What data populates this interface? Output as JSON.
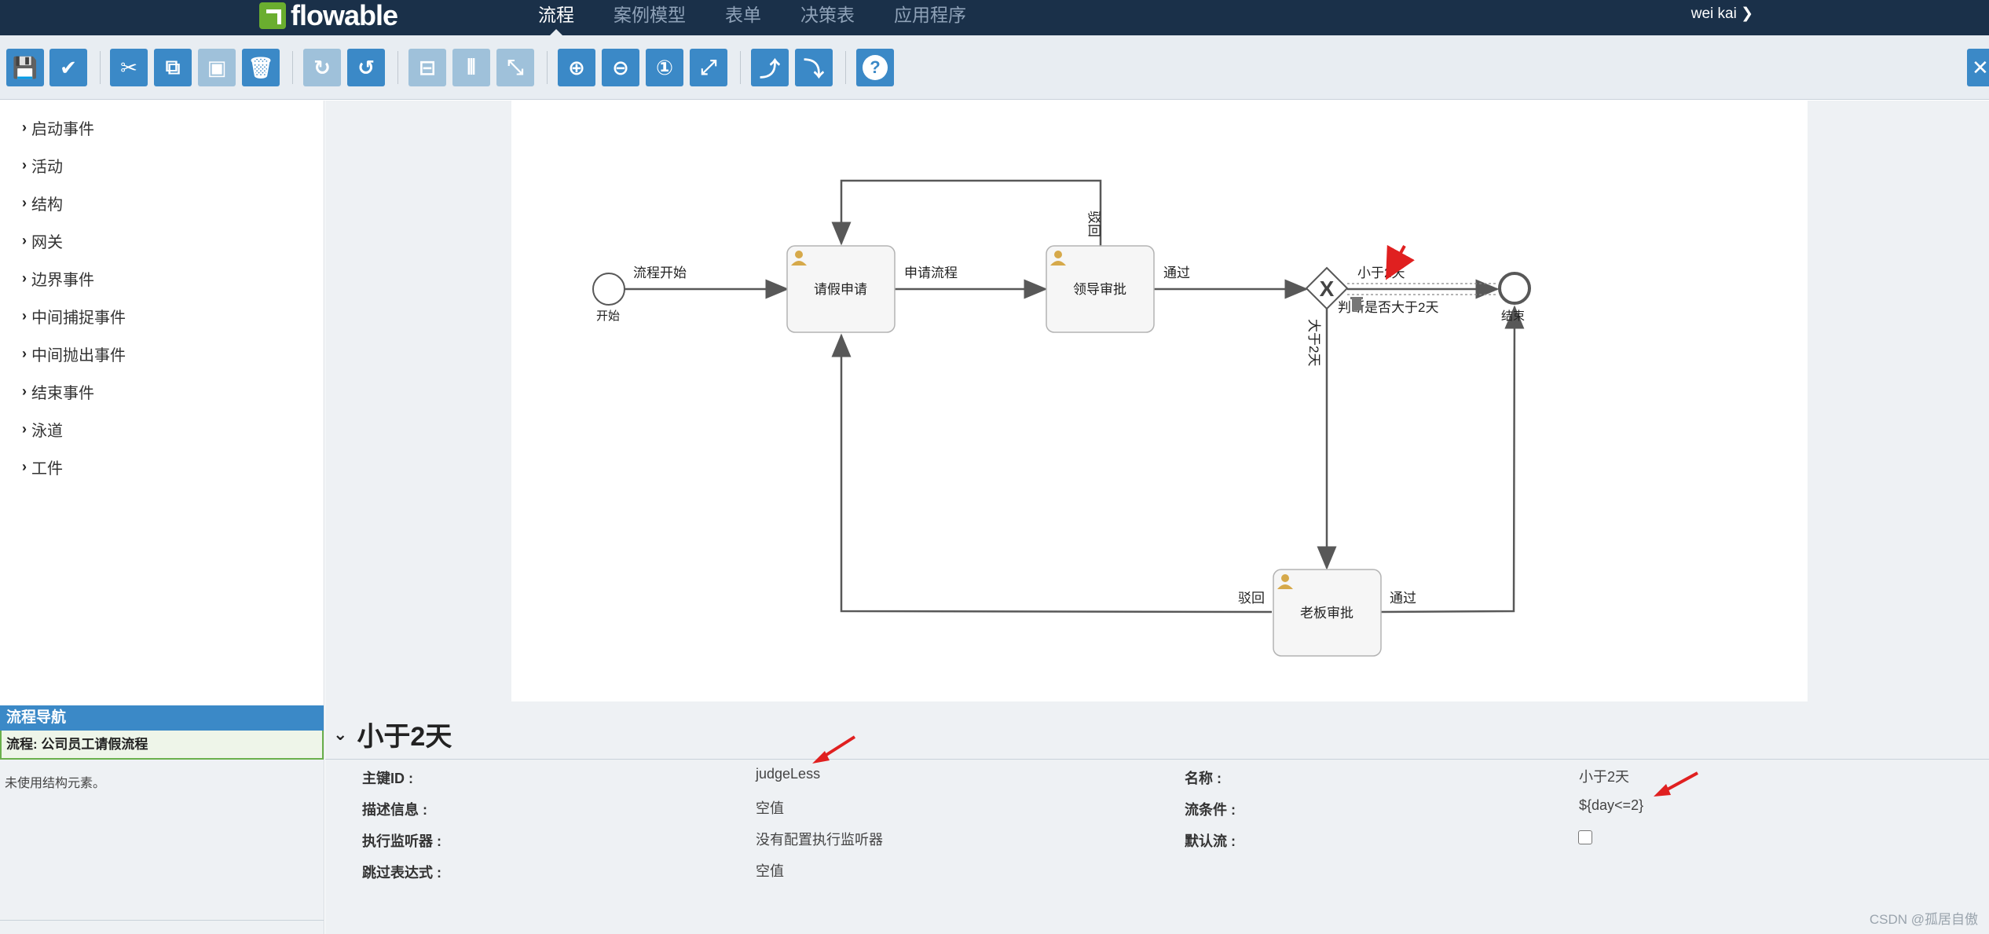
{
  "app": {
    "logo": "flowable",
    "user": "wei kai ❯"
  },
  "nav": {
    "tabs": [
      "流程",
      "案例模型",
      "表单",
      "决策表",
      "应用程序"
    ]
  },
  "toolbar": {
    "buttons": [
      "save-icon",
      "check-icon",
      "cut-icon",
      "copy-icon",
      "paste-icon",
      "delete-icon",
      "redo-icon",
      "undo-icon",
      "align-horizontal-icon",
      "align-vertical-icon",
      "same-size-icon",
      "zoom-in-icon",
      "zoom-out-icon",
      "zoom-actual-icon",
      "zoom-fit-icon",
      "add-bendpoint-icon",
      "remove-bendpoint-icon",
      "help-icon"
    ]
  },
  "palette": {
    "items": [
      "启动事件",
      "活动",
      "结构",
      "网关",
      "边界事件",
      "中间捕捉事件",
      "中间抛出事件",
      "结束事件",
      "泳道",
      "工件"
    ]
  },
  "diagram": {
    "start_label": "开始",
    "end_label": "结束",
    "gateway_label": "判断是否大于2天",
    "tasks": [
      "请假申请",
      "领导审批",
      "老板审批"
    ],
    "flows": {
      "start": "流程开始",
      "apply": "申请流程",
      "pass1": "通过",
      "reject1": "驳回",
      "less": "小于2天",
      "more": "大于2天",
      "reject2": "驳回",
      "pass2": "通过"
    }
  },
  "navigator": {
    "header": "流程导航",
    "process": "流程: 公司员工请假流程",
    "empty": "未使用结构元素。"
  },
  "properties": {
    "title": "小于2天",
    "labels": {
      "id": "主键ID :",
      "desc": "描述信息 :",
      "listener": "执行监听器 :",
      "skip": "跳过表达式 :",
      "name": "名称 :",
      "condition": "流条件 :",
      "default": "默认流 :"
    },
    "values": {
      "id": "judgeLess",
      "desc": "空值",
      "listener": "没有配置执行监听器",
      "skip": "空值",
      "name": "小于2天",
      "condition": "${day<=2}"
    }
  },
  "watermark": "CSDN @孤居自傲",
  "colors": {
    "navbar": "#1a3049",
    "accent": "#3b89c7",
    "annotation": "#e02020"
  }
}
